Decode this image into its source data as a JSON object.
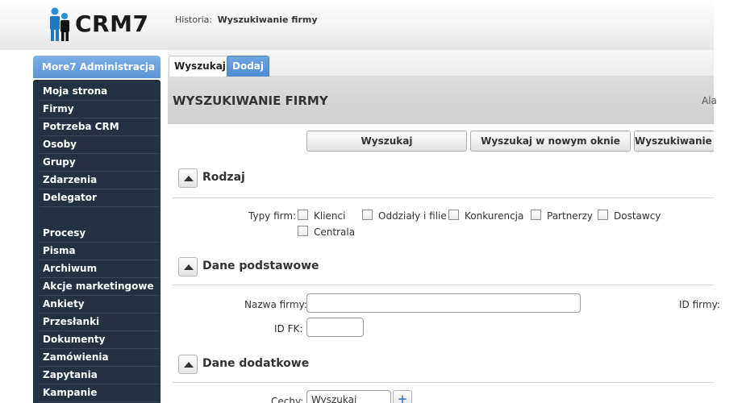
{
  "app": {
    "name": "CRM7",
    "logo_icon": "people-logo-icon"
  },
  "breadcrumb": {
    "label": "Historia:",
    "current": "Wyszukiwanie firmy"
  },
  "sidebar": {
    "header": "More7 Administracja",
    "items": [
      "Moja strona",
      "Firmy",
      "Potrzeba CRM",
      "Osoby",
      "Grupy",
      "Zdarzenia",
      "Delegator",
      "Procesy",
      "Pisma",
      "Archiwum",
      "Akcje marketingowe",
      "Ankiety",
      "Przesłanki",
      "Dokumenty",
      "Zamówienia",
      "Zapytania",
      "Kampanie"
    ]
  },
  "tabs": {
    "search": "Wyszukaj",
    "add": "Dodaj"
  },
  "page": {
    "title": "WYSZUKIWANIE FIRMY",
    "right_text": "Ala"
  },
  "actions": {
    "search": "Wyszukaj",
    "search_new_window": "Wyszukaj w nowym oknie",
    "search_third": "Wyszukiwanie z"
  },
  "sections": {
    "type": {
      "title": "Rodzaj",
      "label": "Typy firm:",
      "options": [
        "Klienci",
        "Oddziały i filie",
        "Konkurencja",
        "Partnerzy",
        "Dostawcy",
        "Centrala"
      ]
    },
    "basic": {
      "title": "Dane podstawowe",
      "name_label": "Nazwa firmy:",
      "name_value": "",
      "id_fk_label": "ID FK:",
      "id_fk_value": "",
      "id_label": "ID firmy:"
    },
    "extra": {
      "title": "Dane dodatkowe",
      "features_label": "Cechy:",
      "features_value": "Wyszukaj"
    }
  },
  "colors": {
    "accent_blue": "#5a93d6",
    "sidebar_bg": "#243142",
    "title_band": "#d4d4d4"
  }
}
